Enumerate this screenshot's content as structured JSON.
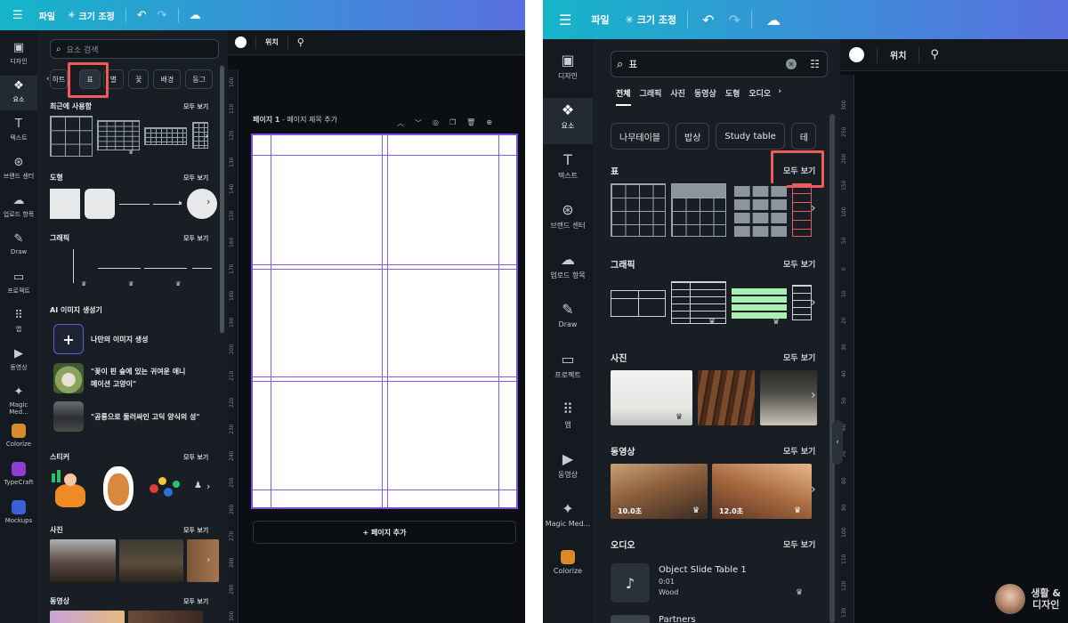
{
  "left": {
    "topbar": {
      "menu_icon": "menu-icon",
      "file": "파일",
      "resize": "크기 조정",
      "undo_icon": "undo-icon",
      "redo_icon": "redo-icon",
      "cloud_icon": "cloud-sync-icon"
    },
    "rail": [
      {
        "label": "디자인",
        "icon": "design-icon"
      },
      {
        "label": "요소",
        "icon": "elements-icon",
        "active": true
      },
      {
        "label": "텍스트",
        "icon": "text-icon"
      },
      {
        "label": "브랜드 센터",
        "icon": "brand-icon"
      },
      {
        "label": "업로드 항목",
        "icon": "upload-icon"
      },
      {
        "label": "Draw",
        "icon": "draw-icon"
      },
      {
        "label": "프로젝트",
        "icon": "folder-icon"
      },
      {
        "label": "앱",
        "icon": "apps-icon"
      },
      {
        "label": "동영상",
        "icon": "video-icon"
      },
      {
        "label": "Magic Med...",
        "icon": "magic-media-icon"
      },
      {
        "label": "Colorize",
        "icon": "colorize-app-icon",
        "color": "#d98a2b"
      },
      {
        "label": "TypeCraft",
        "icon": "typecraft-app-icon",
        "color": "#8a3fd1"
      },
      {
        "label": "Mockups",
        "icon": "mockups-app-icon",
        "color": "#3a5fd9"
      }
    ],
    "panel": {
      "search_placeholder": "요소 검색",
      "chips": [
        "하트",
        "표",
        "별",
        "꽃",
        "배경",
        "동그"
      ],
      "recent": {
        "title": "최근에 사용함",
        "more": "모두 보기"
      },
      "shapes": {
        "title": "도형",
        "more": "모두 보기"
      },
      "graphics": {
        "title": "그래픽",
        "more": "모두 보기"
      },
      "ai": {
        "title": "AI 이미지 생성기",
        "items": [
          "나만의 이미지 생성",
          "\"꽃이 핀 숲에 있는 귀여운 애니메이션 고양이\"",
          "\"공룡으로 둘러싸인 고딕 양식의 성\""
        ]
      },
      "stickers": {
        "title": "스티커",
        "more": "모두 보기"
      },
      "photos": {
        "title": "사진",
        "more": "모두 보기"
      },
      "videos": {
        "title": "동영상",
        "more": "모두 보기"
      }
    },
    "editor": {
      "position": "위치",
      "page_label": "페이지 1",
      "page_title_placeholder": "페이지 제목 추가",
      "add_page": "+ 페이지 추가",
      "ruler": [
        "100",
        "110",
        "120",
        "130",
        "140",
        "150",
        "160",
        "170",
        "180",
        "190",
        "200",
        "210",
        "220",
        "230",
        "240",
        "250",
        "260",
        "270",
        "280",
        "290",
        "300"
      ]
    },
    "highlight_color": "#ef5b5b"
  },
  "right": {
    "topbar": {
      "file": "파일",
      "resize": "크기 조정"
    },
    "rail": [
      {
        "label": "디자인",
        "icon": "design-icon"
      },
      {
        "label": "요소",
        "icon": "elements-icon",
        "active": true
      },
      {
        "label": "텍스트",
        "icon": "text-icon"
      },
      {
        "label": "브랜드 센터",
        "icon": "brand-icon"
      },
      {
        "label": "업로드 항목",
        "icon": "upload-icon"
      },
      {
        "label": "Draw",
        "icon": "draw-icon"
      },
      {
        "label": "프로젝트",
        "icon": "folder-icon"
      },
      {
        "label": "앱",
        "icon": "apps-icon"
      },
      {
        "label": "동영상",
        "icon": "video-icon"
      },
      {
        "label": "Magic Med...",
        "icon": "magic-media-icon"
      },
      {
        "label": "Colorize",
        "icon": "colorize-app-icon",
        "color": "#d98a2b"
      }
    ],
    "panel": {
      "search_value": "표",
      "tabs": [
        "전체",
        "그래픽",
        "사진",
        "동영상",
        "도형",
        "오디오"
      ],
      "tags": [
        "나무테이블",
        "밥상",
        "Study table",
        "테"
      ],
      "tables": {
        "title": "표",
        "more": "모두 보기"
      },
      "graphics": {
        "title": "그래픽",
        "more": "모두 보기"
      },
      "photos": {
        "title": "사진",
        "more": "모두 보기"
      },
      "videos": {
        "title": "동영상",
        "more": "모두 보기",
        "durations": [
          "10.0초",
          "12.0초"
        ]
      },
      "audio": {
        "title": "오디오",
        "more": "모두 보기",
        "track_title": "Object Slide Table 1",
        "track_duration": "0:01",
        "track_artist": "Wood",
        "next_track": "Partners"
      }
    },
    "editor": {
      "position": "위치",
      "ruler": [
        "300",
        "250",
        "200",
        "150",
        "100",
        "50",
        "0",
        "10",
        "20",
        "30",
        "40",
        "50",
        "60",
        "70",
        "80",
        "90",
        "100",
        "110",
        "120",
        "130",
        "140"
      ]
    },
    "watermark": [
      "생활 &",
      "디자인"
    ]
  }
}
